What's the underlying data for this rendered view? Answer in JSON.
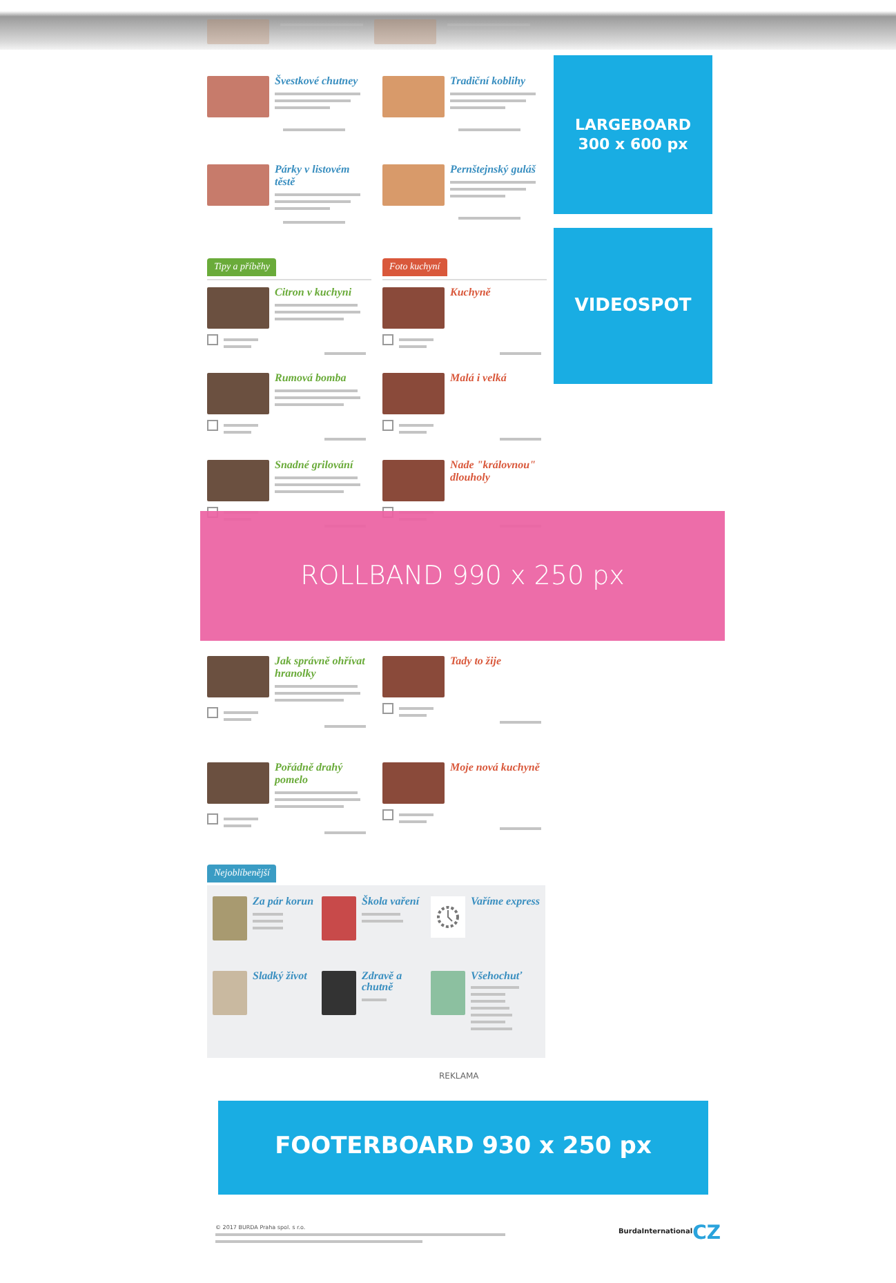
{
  "recipes": [
    {
      "title": "Švestkové chutney"
    },
    {
      "title": "Tradiční koblihy"
    },
    {
      "title": "Párky v listovém těstě"
    },
    {
      "title": "Pernštejnský guláš"
    }
  ],
  "sections": [
    {
      "tag": "Tipy a příběhy",
      "kind": "tips",
      "color": "#6aab3a",
      "items": [
        {
          "title": "Citron v kuchyni"
        },
        {
          "title": "Rumová bomba"
        },
        {
          "title": "Snadné grilování"
        },
        {
          "title": "Jak správně ohřívat hranolky"
        },
        {
          "title": "Pořádně drahý pomelo"
        }
      ]
    },
    {
      "tag": "Foto kuchyní",
      "kind": "photos",
      "color": "#d9583b",
      "items": [
        {
          "title": "Kuchyně"
        },
        {
          "title": "Malá i velká"
        },
        {
          "title": "Nade \"královnou\" dlouholy"
        },
        {
          "title": "Tady to žije"
        },
        {
          "title": "Moje nová kuchyně"
        }
      ]
    }
  ],
  "ads": {
    "largeboard": [
      "LARGEBOARD",
      "300 x 600 px"
    ],
    "videospot": "VIDEOSPOT",
    "rollband": "ROLLBAND 990 x 250 px",
    "label": "REKLAMA",
    "footerboard": "FOOTERBOARD 930 x 250 px"
  },
  "favorites": {
    "tag": "Nejoblíbenější",
    "items": [
      {
        "title": "Za pár korun",
        "kind": "photo"
      },
      {
        "title": "Škola vaření",
        "kind": "photo"
      },
      {
        "title": "Vaříme express",
        "kind": "icon"
      },
      {
        "title": "Sladký život",
        "kind": "photo"
      },
      {
        "title": "Zdravě a chutně",
        "kind": "photo"
      },
      {
        "title": "Všehochuť",
        "kind": "photo"
      }
    ]
  },
  "footer": {
    "copyright": "© 2017 BURDA Praha spol. s r.o.",
    "logo": [
      "BurdaInternational",
      "CZ"
    ]
  }
}
